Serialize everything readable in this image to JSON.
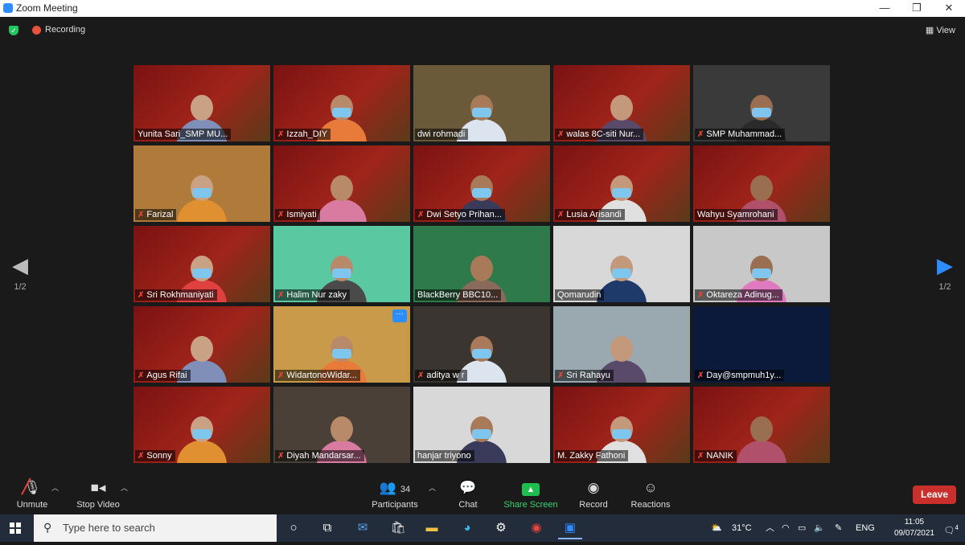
{
  "window": {
    "title": "Zoom Meeting",
    "controls": {
      "minimize": "—",
      "restore": "❐",
      "close": "✕"
    }
  },
  "meeting": {
    "recording_label": "Recording",
    "view_label": "View",
    "page_indicator_left": "1/2",
    "page_indicator_right": "1/2"
  },
  "participants": [
    {
      "name": "Yunita Sari_SMP MU...",
      "muted": false,
      "active": true
    },
    {
      "name": "Izzah_DIY",
      "muted": true
    },
    {
      "name": "dwi rohmadi",
      "muted": false
    },
    {
      "name": "walas 8C-siti Nur...",
      "muted": true
    },
    {
      "name": "SMP Muhammad...",
      "muted": true
    },
    {
      "name": "Farizal",
      "muted": true
    },
    {
      "name": "Ismiyati",
      "muted": true
    },
    {
      "name": "Dwi Setyo Prihan...",
      "muted": true
    },
    {
      "name": "Lusia Arisandi",
      "muted": true
    },
    {
      "name": "Wahyu Syamrohani",
      "muted": false
    },
    {
      "name": "Sri Rokhmaniyati",
      "muted": true
    },
    {
      "name": "Halim Nur zaky",
      "muted": true
    },
    {
      "name": "BlackBerry BBC10...",
      "muted": false
    },
    {
      "name": "Qomarudin",
      "muted": false
    },
    {
      "name": "Oktareza Adinug...",
      "muted": true
    },
    {
      "name": "Agus Rifai",
      "muted": true
    },
    {
      "name": "WidartonoWidar...",
      "muted": true,
      "more": true
    },
    {
      "name": "aditya w r",
      "muted": true
    },
    {
      "name": "Sri Rahayu",
      "muted": true
    },
    {
      "name": "Day@smpmuh1y...",
      "muted": true
    },
    {
      "name": "Sonny",
      "muted": true
    },
    {
      "name": "Diyah Mandarsar...",
      "muted": true
    },
    {
      "name": "hanjar triyono",
      "muted": false
    },
    {
      "name": "M. Zakky Fathoni",
      "muted": false
    },
    {
      "name": "NANIK",
      "muted": true
    }
  ],
  "toolbar": {
    "unmute": "Unmute",
    "stop_video": "Stop Video",
    "participants": "Participants",
    "participants_count": "34",
    "chat": "Chat",
    "share_screen": "Share Screen",
    "record": "Record",
    "reactions": "Reactions",
    "leave": "Leave"
  },
  "taskbar": {
    "search_placeholder": "Type here to search",
    "temperature": "31°C",
    "language": "ENG",
    "time": "11:05",
    "date": "09/07/2021",
    "notifications": "4"
  }
}
